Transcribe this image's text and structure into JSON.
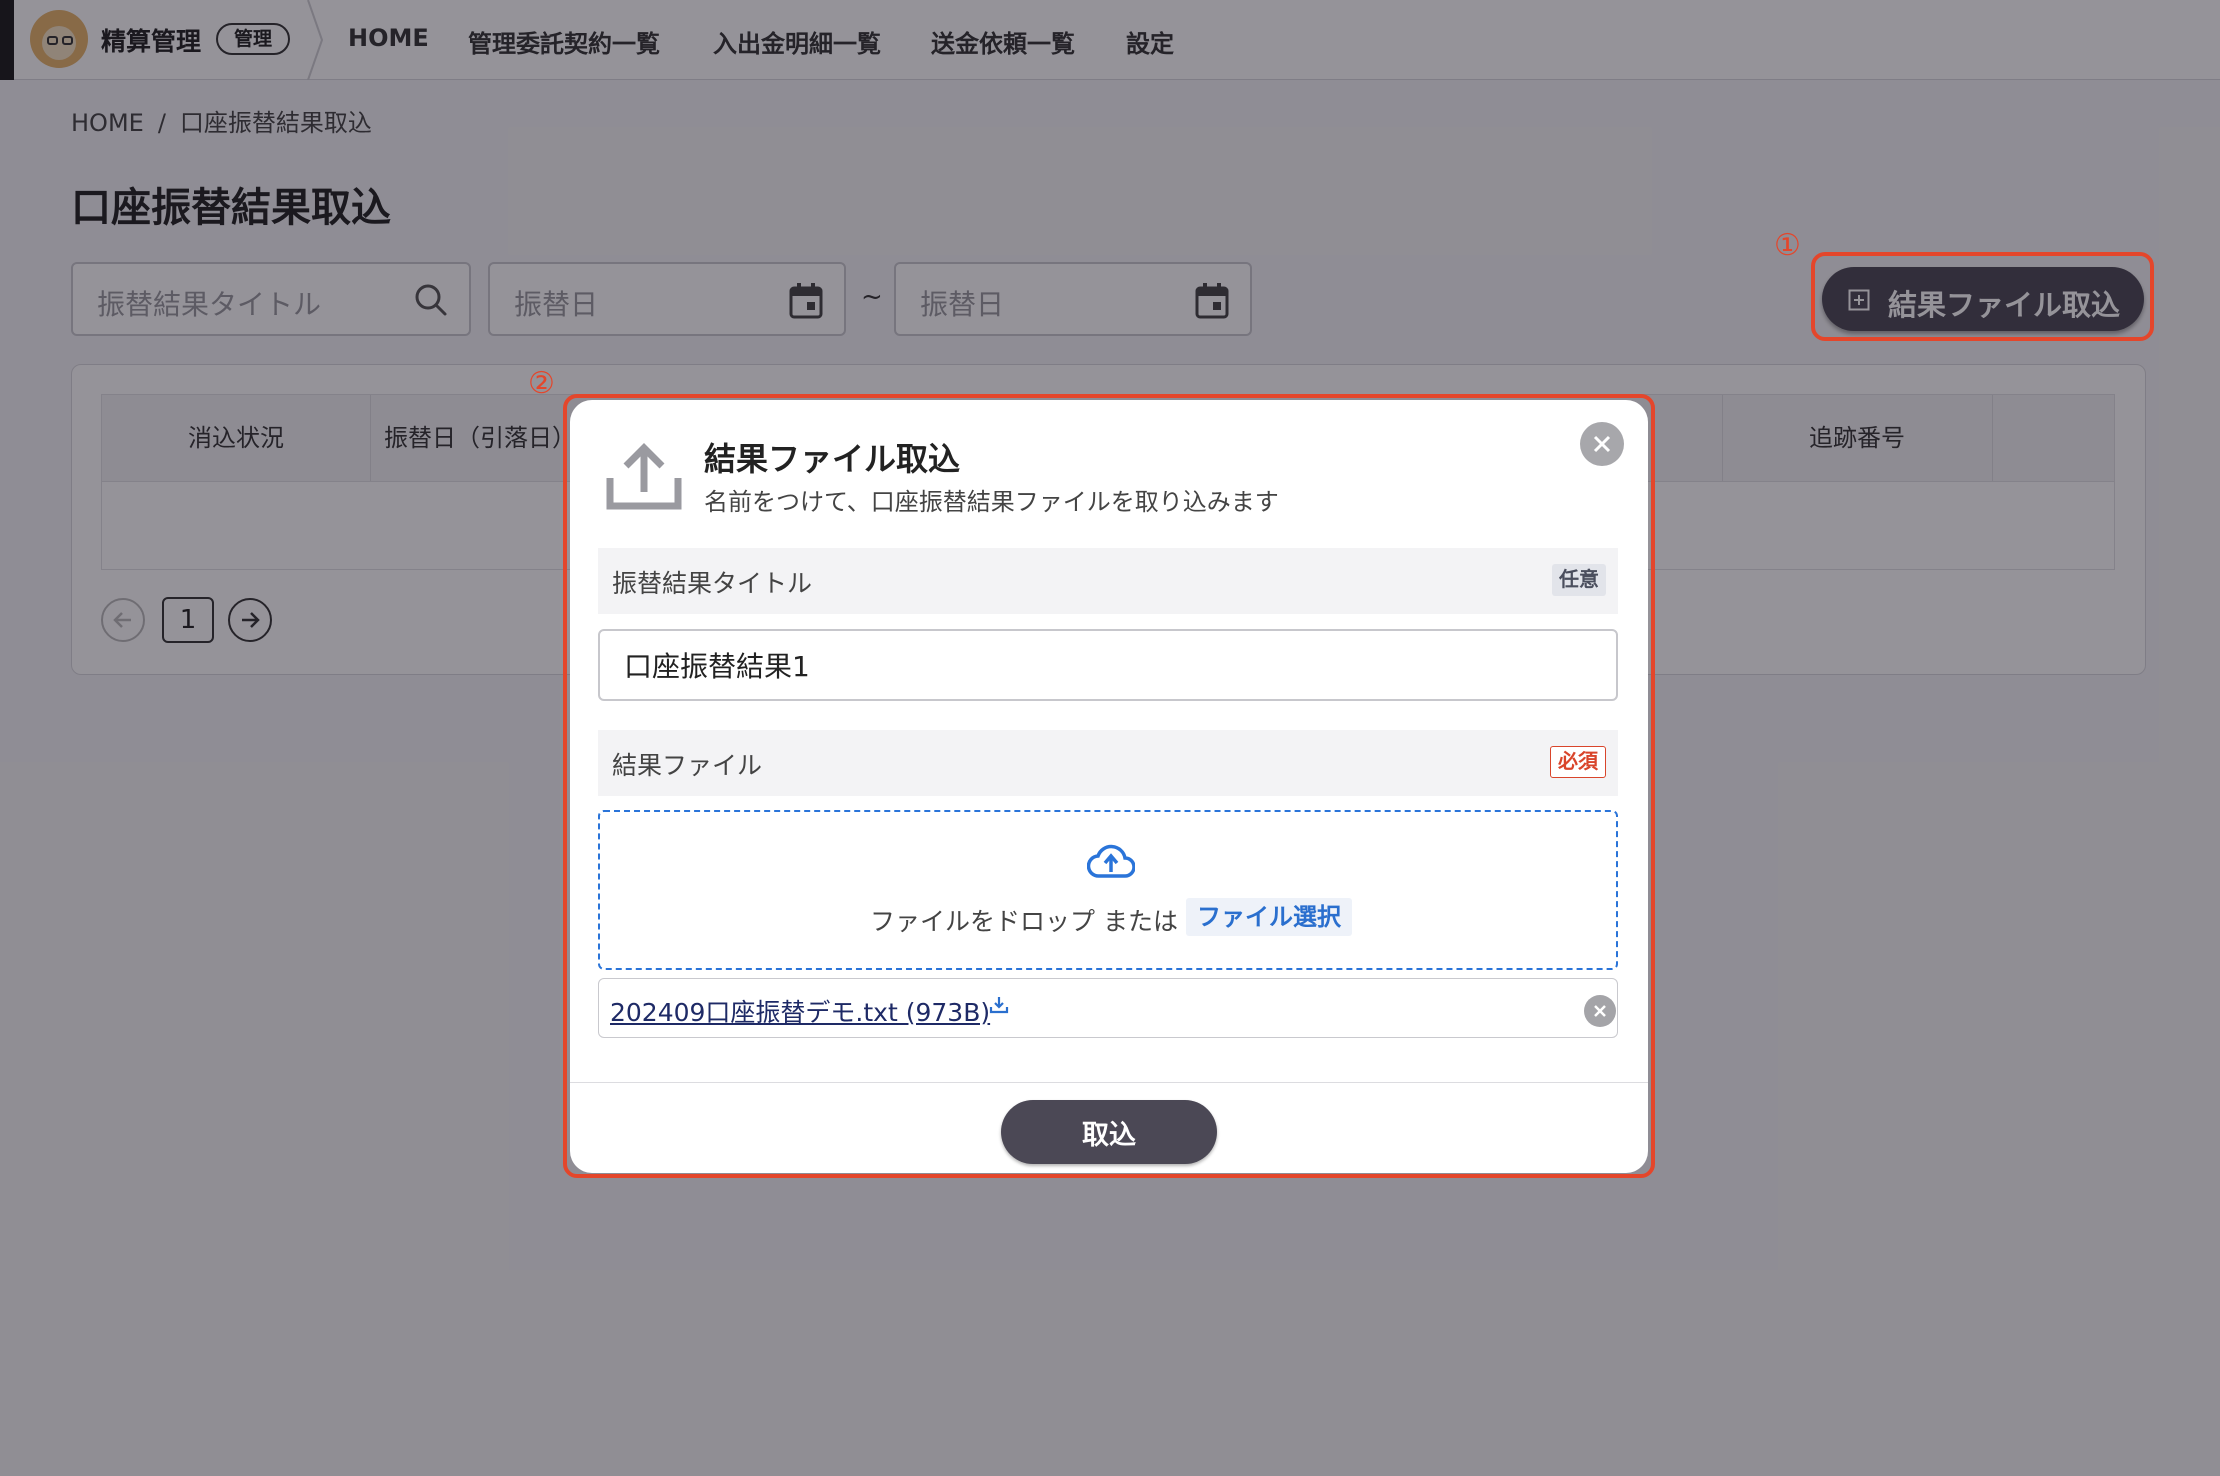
{
  "header": {
    "brand_name": "精算管理",
    "brand_badge": "管理",
    "nav": [
      "HOME",
      "管理委託契約一覧",
      "入出金明細一覧",
      "送金依頼一覧",
      "設定"
    ]
  },
  "breadcrumb": {
    "home": "HOME",
    "separator": "/",
    "current": "口座振替結果取込"
  },
  "page_title": "口座振替結果取込",
  "filters": {
    "title_placeholder": "振替結果タイトル",
    "date_from_placeholder": "振替日",
    "date_to_placeholder": "振替日",
    "range_separator": "~"
  },
  "annotations": {
    "first": "①",
    "second": "②"
  },
  "import_button_label": "結果ファイル取込",
  "table": {
    "columns": [
      "消込状況",
      "振替日（引落日）",
      "追跡番号"
    ]
  },
  "pagination": {
    "current_page": "1"
  },
  "modal": {
    "title": "結果ファイル取込",
    "subtitle": "名前をつけて、口座振替結果ファイルを取り込みます",
    "title_section_label": "振替結果タイトル",
    "title_section_tag": "任意",
    "title_value": "口座振替結果1",
    "file_section_label": "結果ファイル",
    "file_section_tag": "必須",
    "drop_text": "ファイルをドロップ または",
    "select_label": "ファイル選択",
    "file_name": "202409口座振替デモ.txt (973B)",
    "submit_label": "取込"
  },
  "colors": {
    "accent_dark": "#4b4855",
    "annotation_red": "#e4462b",
    "link_blue": "#2a6fce",
    "required_red": "#d9452b"
  }
}
